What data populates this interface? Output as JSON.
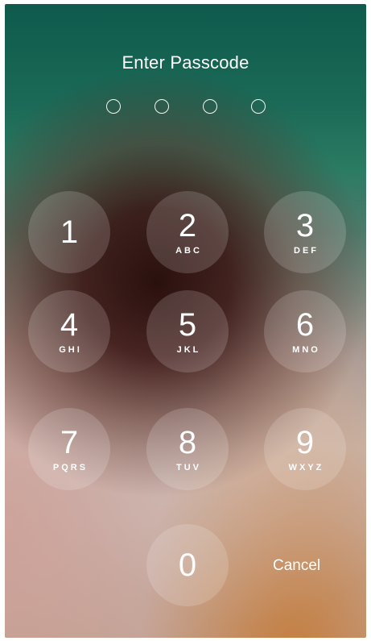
{
  "lock_screen": {
    "title": "Enter Passcode",
    "passcode_dots_filled": 0,
    "passcode_dots_total": 4,
    "cancel_label": "Cancel",
    "keys": [
      {
        "digit": "1",
        "letters": ""
      },
      {
        "digit": "2",
        "letters": "ABC"
      },
      {
        "digit": "3",
        "letters": "DEF"
      },
      {
        "digit": "4",
        "letters": "GHI"
      },
      {
        "digit": "5",
        "letters": "JKL"
      },
      {
        "digit": "6",
        "letters": "MNO"
      },
      {
        "digit": "7",
        "letters": "PQRS"
      },
      {
        "digit": "8",
        "letters": "TUV"
      },
      {
        "digit": "9",
        "letters": "WXYZ"
      },
      {
        "digit": "0",
        "letters": ""
      }
    ]
  },
  "colors": {
    "text": "#ffffff",
    "key_fill": "rgba(255,255,255,0.16)",
    "background_top": "#0f5a4c",
    "background_bottom": "#c3a69a"
  }
}
